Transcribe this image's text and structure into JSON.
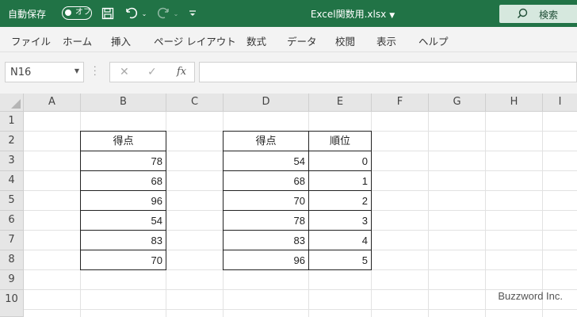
{
  "titlebar": {
    "autosave_label": "自動保存",
    "autosave_state": "オフ",
    "filename": "Excel関数用.xlsx",
    "search_label": "検索",
    "icons": [
      "save-icon",
      "undo-icon",
      "redo-icon",
      "customize-icon",
      "search-icon"
    ]
  },
  "ribbon": {
    "tabs": [
      "ファイル",
      "ホーム",
      "挿入",
      "ページ レイアウト",
      "数式",
      "データ",
      "校閲",
      "表示",
      "ヘルプ"
    ]
  },
  "formula_bar": {
    "name_box": "N16",
    "fx_label": "fx",
    "formula": ""
  },
  "sheet": {
    "columns": [
      "A",
      "B",
      "C",
      "D",
      "E",
      "F",
      "G",
      "H",
      "I"
    ],
    "rows": [
      "1",
      "2",
      "3",
      "4",
      "5",
      "6",
      "7",
      "8",
      "9",
      "10"
    ],
    "table1": {
      "header": "得点",
      "values": [
        "78",
        "68",
        "96",
        "54",
        "83",
        "70"
      ]
    },
    "table2": {
      "headers": [
        "得点",
        "順位"
      ],
      "rows": [
        [
          "54",
          "0"
        ],
        [
          "68",
          "1"
        ],
        [
          "70",
          "2"
        ],
        [
          "78",
          "3"
        ],
        [
          "83",
          "4"
        ],
        [
          "96",
          "5"
        ]
      ]
    }
  },
  "watermark": "Buzzword Inc.",
  "colors": {
    "titlebar": "#217346",
    "ribbon_bg": "#f3f3f3",
    "header_bg": "#e6e6e6",
    "gridline": "#e2e2e2"
  }
}
